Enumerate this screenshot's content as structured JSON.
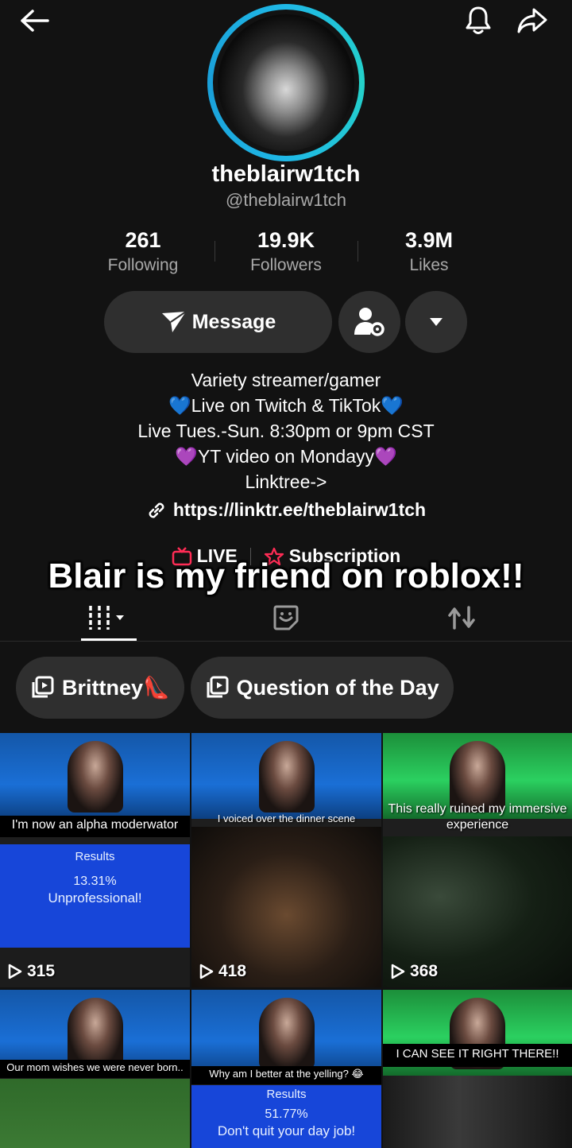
{
  "profile": {
    "nickname": "theblairw1tch",
    "handle": "@theblairw1tch"
  },
  "stats": [
    {
      "value": "261",
      "label": "Following"
    },
    {
      "value": "19.9K",
      "label": "Followers"
    },
    {
      "value": "3.9M",
      "label": "Likes"
    }
  ],
  "actions": {
    "message_label": "Message"
  },
  "bio": [
    "Variety streamer/gamer",
    "💙Live on Twitch & TikTok💙",
    "Live Tues.-Sun. 8:30pm or 9pm CST",
    "💜YT video on Mondayy💜",
    "Linktree->"
  ],
  "link": "https://linktr.ee/theblairw1tch",
  "live_row": {
    "live_label": "LIVE",
    "subscription_label": "Subscription"
  },
  "overlay_caption": "Blair is my friend on roblox!!",
  "playlists": [
    {
      "label": "Brittney👠"
    },
    {
      "label": "Question of the Day"
    }
  ],
  "videos": [
    {
      "caption": "I'm now an alpha moderwator",
      "views": "315",
      "theme": "blue",
      "results_title": "Results",
      "results_value": "13.31%",
      "results_desc": "Unprofessional!"
    },
    {
      "caption": "I voiced over the dinner scene",
      "views": "418",
      "theme": "blue"
    },
    {
      "caption": "This really ruined my immersive experience",
      "views": "368",
      "theme": "green"
    },
    {
      "caption": "Our mom wishes we were never born..",
      "theme": "blue"
    },
    {
      "caption": "Why am I better at the yelling? 😂",
      "theme": "blue",
      "results_title": "Results",
      "results_value": "51.77%",
      "results_desc": "Don't quit your day job!"
    },
    {
      "caption": "I CAN SEE IT RIGHT THERE!!",
      "theme": "green"
    }
  ],
  "colors": {
    "background": "#121212",
    "button": "#2f2f2f",
    "ring": "#1fb8e6",
    "live": "#fe2c55"
  }
}
